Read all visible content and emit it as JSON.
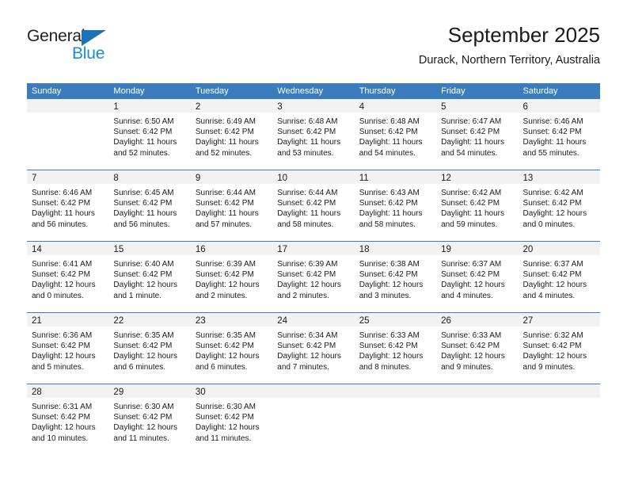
{
  "logo": {
    "text_top": "General",
    "text_bottom": "Blue",
    "triangle_color": "#1b72b8",
    "blue_color": "#1b8cd8"
  },
  "header": {
    "title": "September 2025",
    "subtitle": "Durack, Northern Territory, Australia"
  },
  "theme": {
    "header_row_bg": "#3a7cbe",
    "daynum_bg": "#f2f2f2",
    "week_divider": "#3a7cbe",
    "text": "#1a1a1a"
  },
  "weekdays": [
    "Sunday",
    "Monday",
    "Tuesday",
    "Wednesday",
    "Thursday",
    "Friday",
    "Saturday"
  ],
  "weeks": [
    [
      {
        "day": "",
        "sunrise": "",
        "sunset": "",
        "daylight1": "",
        "daylight2": ""
      },
      {
        "day": "1",
        "sunrise": "Sunrise: 6:50 AM",
        "sunset": "Sunset: 6:42 PM",
        "daylight1": "Daylight: 11 hours",
        "daylight2": "and 52 minutes."
      },
      {
        "day": "2",
        "sunrise": "Sunrise: 6:49 AM",
        "sunset": "Sunset: 6:42 PM",
        "daylight1": "Daylight: 11 hours",
        "daylight2": "and 52 minutes."
      },
      {
        "day": "3",
        "sunrise": "Sunrise: 6:48 AM",
        "sunset": "Sunset: 6:42 PM",
        "daylight1": "Daylight: 11 hours",
        "daylight2": "and 53 minutes."
      },
      {
        "day": "4",
        "sunrise": "Sunrise: 6:48 AM",
        "sunset": "Sunset: 6:42 PM",
        "daylight1": "Daylight: 11 hours",
        "daylight2": "and 54 minutes."
      },
      {
        "day": "5",
        "sunrise": "Sunrise: 6:47 AM",
        "sunset": "Sunset: 6:42 PM",
        "daylight1": "Daylight: 11 hours",
        "daylight2": "and 54 minutes."
      },
      {
        "day": "6",
        "sunrise": "Sunrise: 6:46 AM",
        "sunset": "Sunset: 6:42 PM",
        "daylight1": "Daylight: 11 hours",
        "daylight2": "and 55 minutes."
      }
    ],
    [
      {
        "day": "7",
        "sunrise": "Sunrise: 6:46 AM",
        "sunset": "Sunset: 6:42 PM",
        "daylight1": "Daylight: 11 hours",
        "daylight2": "and 56 minutes."
      },
      {
        "day": "8",
        "sunrise": "Sunrise: 6:45 AM",
        "sunset": "Sunset: 6:42 PM",
        "daylight1": "Daylight: 11 hours",
        "daylight2": "and 56 minutes."
      },
      {
        "day": "9",
        "sunrise": "Sunrise: 6:44 AM",
        "sunset": "Sunset: 6:42 PM",
        "daylight1": "Daylight: 11 hours",
        "daylight2": "and 57 minutes."
      },
      {
        "day": "10",
        "sunrise": "Sunrise: 6:44 AM",
        "sunset": "Sunset: 6:42 PM",
        "daylight1": "Daylight: 11 hours",
        "daylight2": "and 58 minutes."
      },
      {
        "day": "11",
        "sunrise": "Sunrise: 6:43 AM",
        "sunset": "Sunset: 6:42 PM",
        "daylight1": "Daylight: 11 hours",
        "daylight2": "and 58 minutes."
      },
      {
        "day": "12",
        "sunrise": "Sunrise: 6:42 AM",
        "sunset": "Sunset: 6:42 PM",
        "daylight1": "Daylight: 11 hours",
        "daylight2": "and 59 minutes."
      },
      {
        "day": "13",
        "sunrise": "Sunrise: 6:42 AM",
        "sunset": "Sunset: 6:42 PM",
        "daylight1": "Daylight: 12 hours",
        "daylight2": "and 0 minutes."
      }
    ],
    [
      {
        "day": "14",
        "sunrise": "Sunrise: 6:41 AM",
        "sunset": "Sunset: 6:42 PM",
        "daylight1": "Daylight: 12 hours",
        "daylight2": "and 0 minutes."
      },
      {
        "day": "15",
        "sunrise": "Sunrise: 6:40 AM",
        "sunset": "Sunset: 6:42 PM",
        "daylight1": "Daylight: 12 hours",
        "daylight2": "and 1 minute."
      },
      {
        "day": "16",
        "sunrise": "Sunrise: 6:39 AM",
        "sunset": "Sunset: 6:42 PM",
        "daylight1": "Daylight: 12 hours",
        "daylight2": "and 2 minutes."
      },
      {
        "day": "17",
        "sunrise": "Sunrise: 6:39 AM",
        "sunset": "Sunset: 6:42 PM",
        "daylight1": "Daylight: 12 hours",
        "daylight2": "and 2 minutes."
      },
      {
        "day": "18",
        "sunrise": "Sunrise: 6:38 AM",
        "sunset": "Sunset: 6:42 PM",
        "daylight1": "Daylight: 12 hours",
        "daylight2": "and 3 minutes."
      },
      {
        "day": "19",
        "sunrise": "Sunrise: 6:37 AM",
        "sunset": "Sunset: 6:42 PM",
        "daylight1": "Daylight: 12 hours",
        "daylight2": "and 4 minutes."
      },
      {
        "day": "20",
        "sunrise": "Sunrise: 6:37 AM",
        "sunset": "Sunset: 6:42 PM",
        "daylight1": "Daylight: 12 hours",
        "daylight2": "and 4 minutes."
      }
    ],
    [
      {
        "day": "21",
        "sunrise": "Sunrise: 6:36 AM",
        "sunset": "Sunset: 6:42 PM",
        "daylight1": "Daylight: 12 hours",
        "daylight2": "and 5 minutes."
      },
      {
        "day": "22",
        "sunrise": "Sunrise: 6:35 AM",
        "sunset": "Sunset: 6:42 PM",
        "daylight1": "Daylight: 12 hours",
        "daylight2": "and 6 minutes."
      },
      {
        "day": "23",
        "sunrise": "Sunrise: 6:35 AM",
        "sunset": "Sunset: 6:42 PM",
        "daylight1": "Daylight: 12 hours",
        "daylight2": "and 6 minutes."
      },
      {
        "day": "24",
        "sunrise": "Sunrise: 6:34 AM",
        "sunset": "Sunset: 6:42 PM",
        "daylight1": "Daylight: 12 hours",
        "daylight2": "and 7 minutes."
      },
      {
        "day": "25",
        "sunrise": "Sunrise: 6:33 AM",
        "sunset": "Sunset: 6:42 PM",
        "daylight1": "Daylight: 12 hours",
        "daylight2": "and 8 minutes."
      },
      {
        "day": "26",
        "sunrise": "Sunrise: 6:33 AM",
        "sunset": "Sunset: 6:42 PM",
        "daylight1": "Daylight: 12 hours",
        "daylight2": "and 9 minutes."
      },
      {
        "day": "27",
        "sunrise": "Sunrise: 6:32 AM",
        "sunset": "Sunset: 6:42 PM",
        "daylight1": "Daylight: 12 hours",
        "daylight2": "and 9 minutes."
      }
    ],
    [
      {
        "day": "28",
        "sunrise": "Sunrise: 6:31 AM",
        "sunset": "Sunset: 6:42 PM",
        "daylight1": "Daylight: 12 hours",
        "daylight2": "and 10 minutes."
      },
      {
        "day": "29",
        "sunrise": "Sunrise: 6:30 AM",
        "sunset": "Sunset: 6:42 PM",
        "daylight1": "Daylight: 12 hours",
        "daylight2": "and 11 minutes."
      },
      {
        "day": "30",
        "sunrise": "Sunrise: 6:30 AM",
        "sunset": "Sunset: 6:42 PM",
        "daylight1": "Daylight: 12 hours",
        "daylight2": "and 11 minutes."
      },
      {
        "day": "",
        "sunrise": "",
        "sunset": "",
        "daylight1": "",
        "daylight2": ""
      },
      {
        "day": "",
        "sunrise": "",
        "sunset": "",
        "daylight1": "",
        "daylight2": ""
      },
      {
        "day": "",
        "sunrise": "",
        "sunset": "",
        "daylight1": "",
        "daylight2": ""
      },
      {
        "day": "",
        "sunrise": "",
        "sunset": "",
        "daylight1": "",
        "daylight2": ""
      }
    ]
  ]
}
